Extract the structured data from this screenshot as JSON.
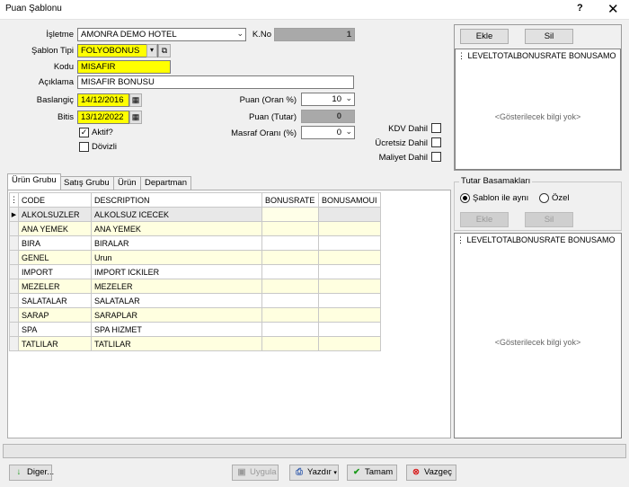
{
  "window": {
    "title": "Puan Şablonu",
    "help_label": "?",
    "close_label": "✕"
  },
  "form": {
    "isletme": {
      "label": "İşletme",
      "value": "AMONRA DEMO HOTEL"
    },
    "kno": {
      "label": "K.No",
      "value": "1"
    },
    "sablon_tipi": {
      "label": "Şablon Tipi",
      "value": "FOLYOBONUS"
    },
    "kodu": {
      "label": "Kodu",
      "value": "MISAFIR"
    },
    "aciklama": {
      "label": "Açıklama",
      "value": "MISAFIR BONUSU"
    },
    "baslangic": {
      "label": "Baslangiç",
      "value": "14/12/2016"
    },
    "bitis": {
      "label": "Bitis",
      "value": "13/12/2022"
    },
    "aktif": {
      "label": "Aktif?",
      "checked": true
    },
    "dovizli": {
      "label": "Dövizli",
      "checked": false
    },
    "puan_oran": {
      "label": "Puan (Oran %)",
      "value": "10"
    },
    "puan_tutar": {
      "label": "Puan (Tutar)",
      "value": "0"
    },
    "masraf_orani": {
      "label": "Masraf Oranı (%)",
      "value": "0"
    },
    "kdv_dahil": {
      "label": "KDV Dahil",
      "checked": false
    },
    "ucretsiz_dahil": {
      "label": "Ücretsiz Dahil",
      "checked": false
    },
    "maliyet_dahil": {
      "label": "Maliyet Dahil",
      "checked": false
    }
  },
  "top_panel": {
    "add_label": "Ekle",
    "delete_label": "Sil",
    "columns": [
      "LEVELTOTAL",
      "BONUSRATE",
      "BONUSAMO"
    ],
    "empty_text": "<Gösterilecek bilgi yok>"
  },
  "tutar_basamaklari": {
    "title": "Tutar Basamakları",
    "radio_sablon": "Şablon ile aynı",
    "radio_ozel": "Özel",
    "selected": "sablon",
    "add_label": "Ekle",
    "delete_label": "Sil",
    "columns": [
      "LEVELTOTAL",
      "BONUSRATE",
      "BONUSAMO"
    ],
    "empty_text": "<Gösterilecek bilgi yok>"
  },
  "tabs": [
    "Ürün Grubu",
    "Satış Grubu",
    "Ürün",
    "Departman"
  ],
  "grid": {
    "columns": [
      "CODE",
      "DESCRIPTION",
      "BONUSRATE",
      "BONUSAMOUI"
    ],
    "rows": [
      [
        "ALKOLSUZLER",
        "ALKOLSUZ ICECEK",
        "",
        ""
      ],
      [
        "ANA YEMEK",
        "ANA YEMEK",
        "",
        ""
      ],
      [
        "BIRA",
        "BIRALAR",
        "",
        ""
      ],
      [
        "GENEL",
        "Urun",
        "",
        ""
      ],
      [
        "IMPORT",
        "IMPORT ICKILER",
        "",
        ""
      ],
      [
        "MEZELER",
        "MEZELER",
        "",
        ""
      ],
      [
        "SALATALAR",
        "SALATALAR",
        "",
        ""
      ],
      [
        "SARAP",
        "SARAPLAR",
        "",
        ""
      ],
      [
        "SPA",
        "SPA HIZMET",
        "",
        ""
      ],
      [
        "TATLILAR",
        "TATLILAR",
        "",
        ""
      ]
    ]
  },
  "footer": {
    "diger_label": "Diger...",
    "uygula_label": "Uygula",
    "yazdir_label": "Yazdır",
    "tamam_label": "Tamam",
    "vazgec_label": "Vazgeç"
  },
  "colors": {
    "required": "#ffff00",
    "readonly": "#a9a9a9",
    "row_alt": "#ffffe0"
  }
}
